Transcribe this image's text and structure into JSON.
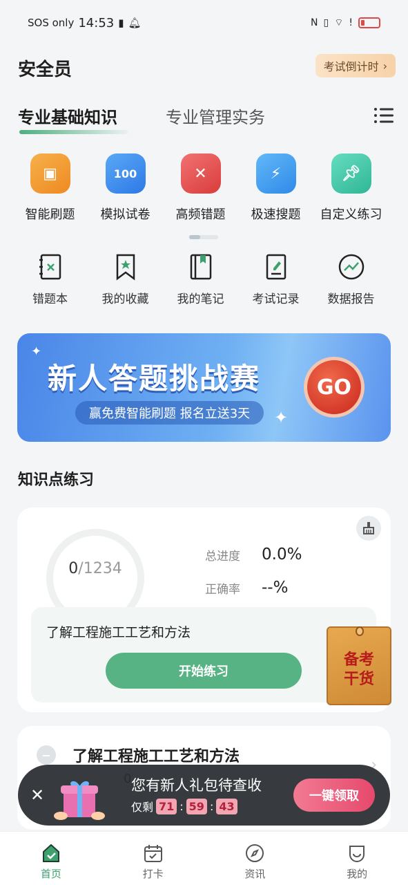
{
  "status_bar": {
    "carrier": "SOS only",
    "time": "14:53"
  },
  "header": {
    "title": "安全员",
    "countdown_label": "考试倒计时"
  },
  "tabs": [
    {
      "label": "专业基础知识",
      "active": true
    },
    {
      "label": "专业管理实务",
      "active": false
    }
  ],
  "features": [
    {
      "label": "智能刷题",
      "icon": "smart-practice-icon",
      "color": "#f39b33"
    },
    {
      "label": "模拟试卷",
      "icon": "mock-exam-icon",
      "color": "#3b8ef0"
    },
    {
      "label": "高频错题",
      "icon": "frequent-errors-icon",
      "color": "#e85252"
    },
    {
      "label": "极速搜题",
      "icon": "quick-search-icon",
      "color": "#3aa0f2"
    },
    {
      "label": "自定义练习",
      "icon": "custom-practice-icon",
      "color": "#43c6a8"
    }
  ],
  "tools": [
    {
      "label": "错题本",
      "icon": "error-book-icon"
    },
    {
      "label": "我的收藏",
      "icon": "bookmark-icon"
    },
    {
      "label": "我的笔记",
      "icon": "notes-icon"
    },
    {
      "label": "考试记录",
      "icon": "exam-record-icon"
    },
    {
      "label": "数据报告",
      "icon": "data-report-icon"
    }
  ],
  "banner": {
    "title": "新人答题挑战赛",
    "subtitle": "赢免费智能刷题  报名立送3天",
    "go_label": "GO"
  },
  "knowledge": {
    "section_title": "知识点练习",
    "done": "0",
    "total": "/1234",
    "progress_label": "总进度",
    "progress_value": "0.0%",
    "accuracy_label": "正确率",
    "accuracy_value": "--%",
    "topic": "了解工程施工工艺和方法",
    "start_label": "开始练习"
  },
  "envelope": {
    "line1": "备考",
    "line2": "干货"
  },
  "topic_card": {
    "title": "了解工程施工工艺和方法",
    "partial_count": "0"
  },
  "gift_toast": {
    "title": "您有新人礼包待查收",
    "remain_label": "仅剩",
    "hours": "71",
    "minutes": "59",
    "seconds": "43",
    "claim_label": "一键领取"
  },
  "bottom_nav": [
    {
      "label": "首页",
      "icon": "home-icon",
      "active": true
    },
    {
      "label": "打卡",
      "icon": "calendar-checkin-icon",
      "active": false
    },
    {
      "label": "资讯",
      "icon": "compass-icon",
      "active": false
    },
    {
      "label": "我的",
      "icon": "profile-icon",
      "active": false
    }
  ],
  "colors": {
    "accent": "#57b383",
    "primary_text": "#1f1f1f",
    "banner_blue": "#4a86e8"
  }
}
